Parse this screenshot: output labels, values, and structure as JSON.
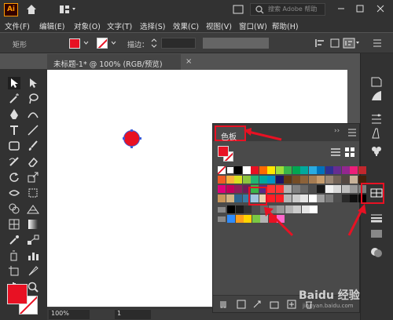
{
  "app": {
    "logo_text": "Ai"
  },
  "titlebar": {
    "search_placeholder": "搜索 Adobe 帮助"
  },
  "menu": [
    "文件(F)",
    "编辑(E)",
    "对象(O)",
    "文字(T)",
    "选择(S)",
    "效果(C)",
    "视图(V)",
    "窗口(W)",
    "帮助(H)"
  ],
  "control": {
    "object_label": "矩形",
    "stroke_label": "描边：",
    "fill_color": "#e81123"
  },
  "document": {
    "tab_title": "未标题-1* @ 100% (RGB/预览)",
    "close": "×"
  },
  "status": {
    "zoom": "100%",
    "page": "1"
  },
  "swatches_panel": {
    "tab_label": "色板",
    "collapse": "››",
    "rows": [
      [
        "none",
        "reg",
        "#000000",
        "#ffffff",
        "#e81123",
        "#ff6a00",
        "#ffe600",
        "#9fde3a",
        "#39b54a",
        "#00a651",
        "#00a99d",
        "#29abe2",
        "#0071bc",
        "#2e3192",
        "#662d91",
        "#93278f",
        "#ed1e79",
        "#c1272d"
      ],
      [
        "#f15a24",
        "#fbb03b",
        "#d9e021",
        "#8cc63f",
        "#22b573",
        "#00a99d",
        "#0093c3",
        "#1b1464",
        "#603813",
        "#754c24",
        "#8c6239",
        "#a67c52",
        "#c69c6d",
        "#998675",
        "#736357",
        "#534741",
        "#c7b299",
        "#42210b"
      ],
      [
        "#e0007a",
        "#c2005a",
        "#8e1e5a",
        "#6e1e59",
        "#39b54a",
        "#5a2c83",
        "#ff3333",
        "#ff3333",
        "#b3b3b3",
        "#808080",
        "#666666",
        "#4d4d4d",
        "#1a1a1a",
        "#f2f2f2",
        "#d9d9d9",
        "#bfbfbf",
        "#999999",
        "#7d7d7d"
      ],
      [
        "#c8965a",
        "#d4b483",
        "#2f6690",
        "#3a7ca5",
        "#a1c5e0",
        "#e8d4b0",
        "#ff1d25",
        "#ff1d25",
        "#b5b5b5",
        "#cccccc",
        "#e6e6e6",
        "#ffffff",
        "#9e9e9e",
        "#7a7a7a",
        "#4e4e4e",
        "#2a2a2a",
        "#111111",
        "#000000"
      ],
      [
        "#000000",
        "#1a1a1a",
        "#333333",
        "#4d4d4d",
        "#666666",
        "#808080",
        "#999999",
        "#b3b3b3",
        "#cccccc",
        "#e6e6e6",
        "#ffffff"
      ],
      [
        "#2e8cff",
        "#ff9f1a",
        "#ffd400",
        "#7ac943",
        "#b3b3b3",
        "#e81123",
        "#ff66cc"
      ]
    ]
  },
  "watermark": {
    "brand": "Baidu 经验",
    "site": "jingyan.baidu.com"
  }
}
